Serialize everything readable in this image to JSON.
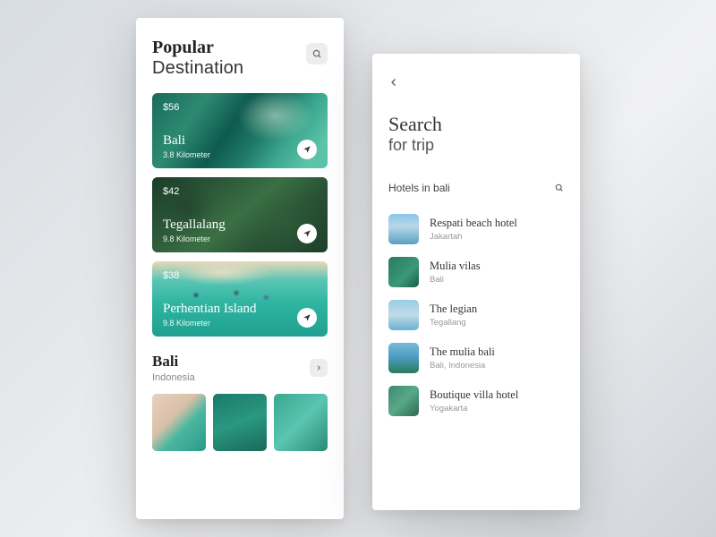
{
  "left": {
    "title_bold": "Popular",
    "title_thin": "Destination",
    "cards": [
      {
        "price": "$56",
        "place": "Bali",
        "dist": "3.8 Kilometer"
      },
      {
        "price": "$42",
        "place": "Tegallalang",
        "dist": "9.8 Kilometer"
      },
      {
        "price": "$38",
        "place": "Perhentian Island",
        "dist": "9.8 Kilometer"
      }
    ],
    "section2_title": "Bali",
    "section2_sub": "Indonesia"
  },
  "right": {
    "title_bold": "Search",
    "title_thin": "for trip",
    "query": "Hotels in bali",
    "results": [
      {
        "name": "Respati beach hotel",
        "loc": "Jakartah"
      },
      {
        "name": "Mulia vilas",
        "loc": "Bali"
      },
      {
        "name": "The legian",
        "loc": "Tegallang"
      },
      {
        "name": "The mulia bali",
        "loc": "Bali, Indonesia"
      },
      {
        "name": "Boutique villa hotel",
        "loc": "Yogakarta"
      }
    ]
  }
}
